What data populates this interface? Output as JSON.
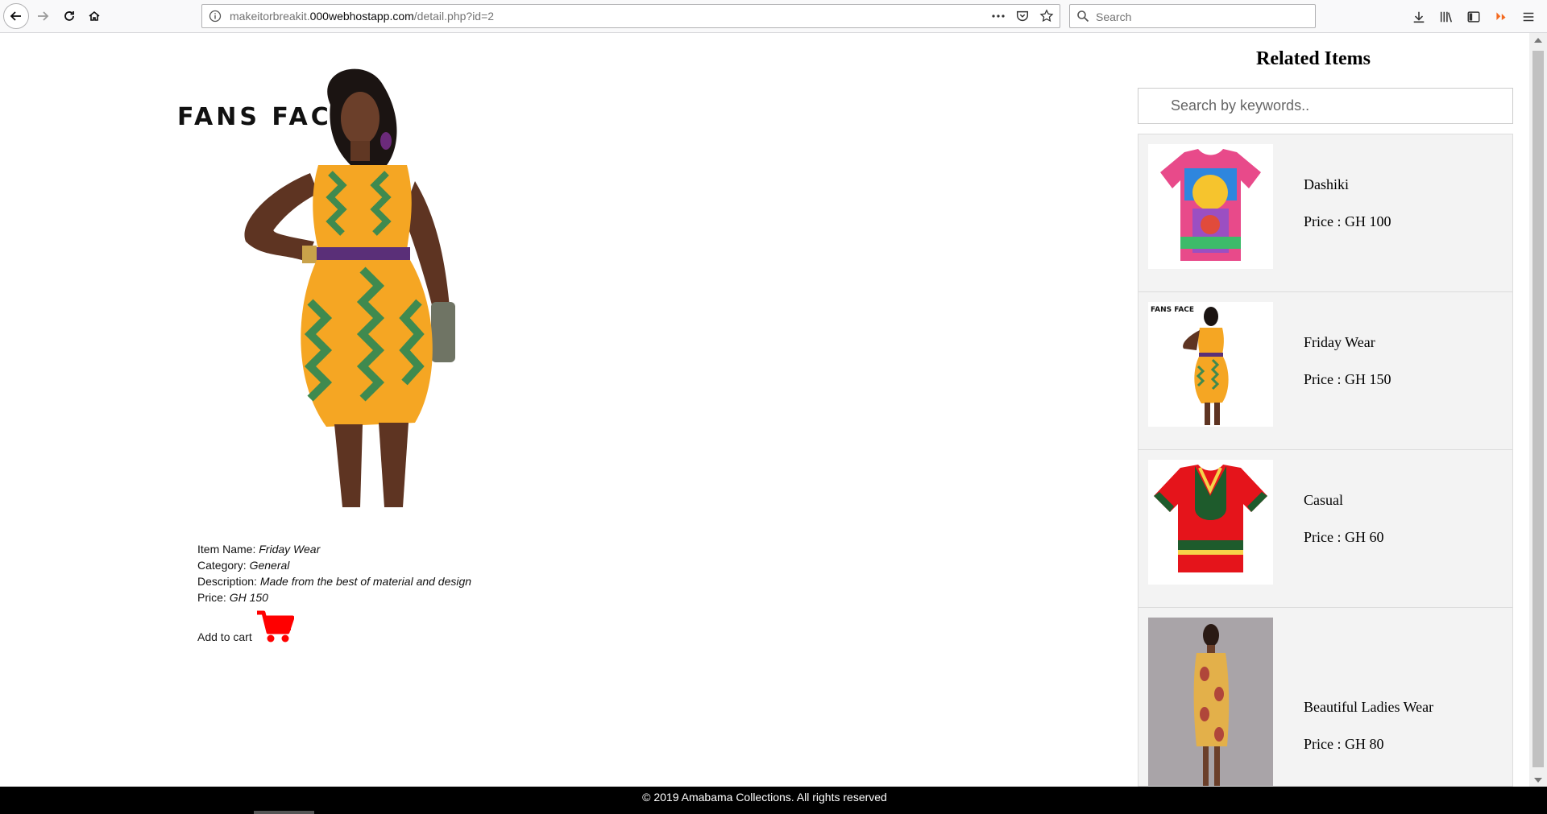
{
  "browser": {
    "url_prefix": "makeitorbreakit.",
    "url_domain": "000webhostapp.com",
    "url_path": "/detail.php?id=2",
    "search_placeholder": "Search"
  },
  "product": {
    "brand": "FANS FACE",
    "item_name_label": "Item Name:",
    "item_name": "Friday Wear",
    "category_label": "Category:",
    "category": "General",
    "description_label": "Description:",
    "description": "Made from the best of material and design",
    "price_label": "Price:",
    "price": "GH 150",
    "add_to_cart": "Add to cart"
  },
  "related": {
    "title": "Related Items",
    "search_placeholder": "Search by keywords..",
    "items": [
      {
        "name": "Dashiki",
        "price": "Price : GH 100"
      },
      {
        "name": "Friday Wear",
        "price": "Price : GH 150"
      },
      {
        "name": "Casual",
        "price": "Price : GH 60"
      },
      {
        "name": "Beautiful Ladies Wear",
        "price": "Price : GH 80"
      }
    ],
    "thumb_brand": "FANS FACE"
  },
  "footer": {
    "text": "© 2019 Amabama Collections. All rights reserved"
  },
  "colors": {
    "cart": "#ff0000",
    "footer_bg": "#000000",
    "dress_orange": "#f5a623",
    "dress_green": "#3f8a4f"
  }
}
